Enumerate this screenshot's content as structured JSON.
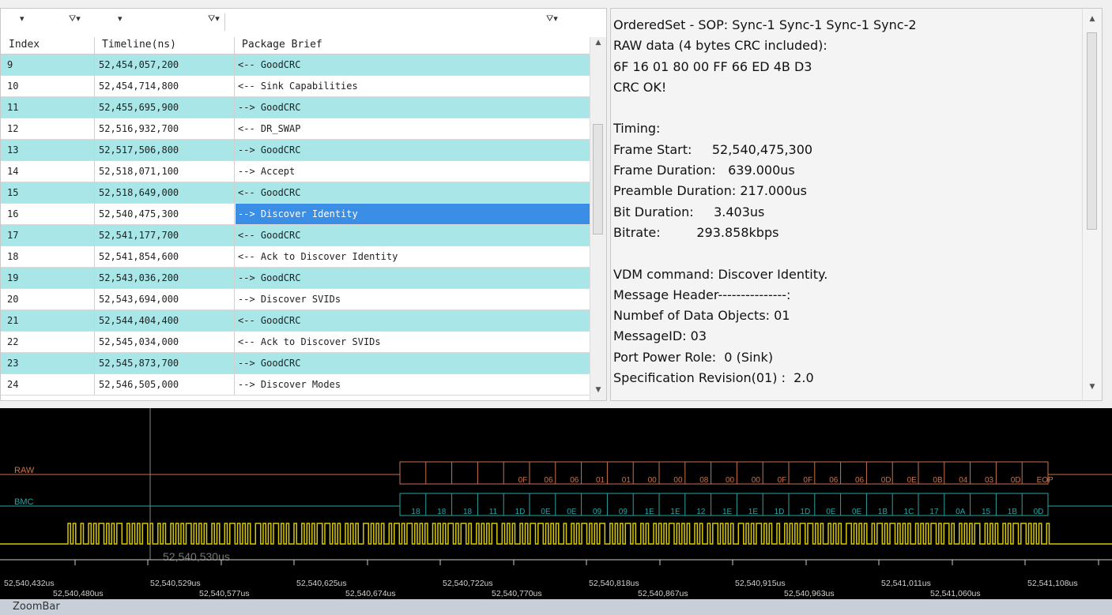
{
  "table": {
    "headers": [
      "Index",
      "Timeline(ns)",
      "Package Brief"
    ],
    "rows": [
      {
        "index": "9",
        "time": "52,454,057,200",
        "brief": "<-- GoodCRC"
      },
      {
        "index": "10",
        "time": "52,454,714,800",
        "brief": "<-- Sink Capabilities"
      },
      {
        "index": "11",
        "time": "52,455,695,900",
        "brief": "--> GoodCRC"
      },
      {
        "index": "12",
        "time": "52,516,932,700",
        "brief": "<-- DR_SWAP"
      },
      {
        "index": "13",
        "time": "52,517,506,800",
        "brief": "--> GoodCRC"
      },
      {
        "index": "14",
        "time": "52,518,071,100",
        "brief": "--> Accept"
      },
      {
        "index": "15",
        "time": "52,518,649,000",
        "brief": "<-- GoodCRC"
      },
      {
        "index": "16",
        "time": "52,540,475,300",
        "brief": "--> Discover Identity"
      },
      {
        "index": "17",
        "time": "52,541,177,700",
        "brief": "<-- GoodCRC"
      },
      {
        "index": "18",
        "time": "52,541,854,600",
        "brief": "<-- Ack to Discover Identity"
      },
      {
        "index": "19",
        "time": "52,543,036,200",
        "brief": "--> GoodCRC"
      },
      {
        "index": "20",
        "time": "52,543,694,000",
        "brief": "--> Discover SVIDs"
      },
      {
        "index": "21",
        "time": "52,544,404,400",
        "brief": "<-- GoodCRC"
      },
      {
        "index": "22",
        "time": "52,545,034,000",
        "brief": "<-- Ack to Discover SVIDs"
      },
      {
        "index": "23",
        "time": "52,545,873,700",
        "brief": "--> GoodCRC"
      },
      {
        "index": "24",
        "time": "52,546,505,000",
        "brief": "--> Discover Modes"
      }
    ],
    "selected_index": 7,
    "row_colors": {
      "alt": "#a8e6e8",
      "plain": "#ffffff",
      "selected": "#3a8ee6"
    }
  },
  "details": {
    "lines": [
      "OrderedSet - SOP: Sync-1 Sync-1 Sync-1 Sync-2",
      "RAW data (4 bytes CRC included):",
      "6F 16 01 80 00 FF 66 ED 4B D3",
      "CRC OK!",
      "",
      "Timing:",
      "Frame Start:     52,540,475,300",
      "Frame Duration:   639.000us",
      "Preamble Duration: 217.000us",
      "Bit Duration:     3.403us",
      "Bitrate:         293.858kbps",
      "",
      "VDM command: Discover Identity.",
      "Message Header---------------:",
      "Numbef of Data Objects: 01",
      "MessageID: 03",
      "Port Power Role:  0 (Sink)",
      "Specification Revision(01) :  2.0"
    ]
  },
  "waveform": {
    "raw_label": "RAW",
    "bmc_label": "BMC",
    "raw_bytes": [
      "0F",
      "06",
      "06",
      "01",
      "01",
      "00",
      "00",
      "08",
      "00",
      "00",
      "0F",
      "0F",
      "06",
      "06",
      "0D",
      "0E",
      "0B",
      "04",
      "03",
      "0D",
      "EOP"
    ],
    "bmc_symbols": [
      "18",
      "18",
      "18",
      "11",
      "1D",
      "0E",
      "0E",
      "09",
      "09",
      "1E",
      "1E",
      "12",
      "1E",
      "1E",
      "1D",
      "1D",
      "0E",
      "0E",
      "1B",
      "1C",
      "17",
      "0A",
      "15",
      "1B",
      "0D"
    ],
    "cursor_label": "52,540,530us",
    "time_labels": [
      {
        "upper": "52,540,432us",
        "lower": "52,540,480us"
      },
      {
        "upper": "52,540,529us",
        "lower": "52,540,577us"
      },
      {
        "upper": "52,540,625us",
        "lower": "52,540,674us"
      },
      {
        "upper": "52,540,722us",
        "lower": "52,540,770us"
      },
      {
        "upper": "52,540,818us",
        "lower": "52,540,867us"
      },
      {
        "upper": "52,540,915us",
        "lower": "52,540,963us"
      },
      {
        "upper": "52,541,011us",
        "lower": "52,541,060us"
      },
      {
        "upper": "52,541,108us",
        "lower": ""
      }
    ],
    "colors": {
      "raw": "#c8744c",
      "bmc": "#2aa3a3",
      "signal": "#d8c800",
      "label": "#d0d0d0"
    }
  },
  "zoombar": {
    "label": "ZoomBar"
  },
  "filters": {
    "col1": "▾",
    "col2": "▾"
  }
}
